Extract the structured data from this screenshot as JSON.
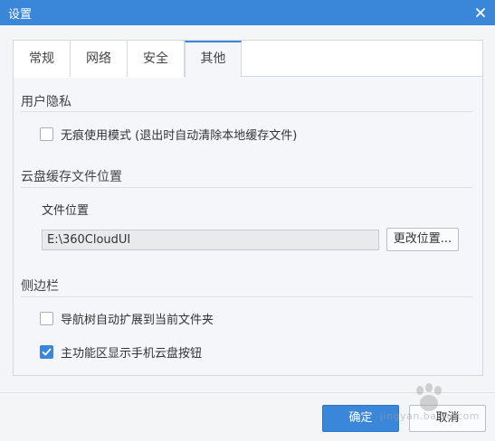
{
  "window": {
    "title": "设置"
  },
  "tabs": [
    {
      "label": "常规"
    },
    {
      "label": "网络"
    },
    {
      "label": "安全"
    },
    {
      "label": "其他"
    }
  ],
  "privacy": {
    "title": "用户隐私",
    "incognito_label": "无痕使用模式 (退出时自动清除本地缓存文件)",
    "incognito_checked": false
  },
  "cache": {
    "title": "云盘缓存文件位置",
    "location_label": "文件位置",
    "location_value": "E:\\360CloudUI",
    "change_button": "更改位置..."
  },
  "sidebar": {
    "title": "侧边栏",
    "options": [
      {
        "label": "导航树自动扩展到当前文件夹",
        "checked": false
      },
      {
        "label": "主功能区显示手机云盘按钮",
        "checked": true
      }
    ]
  },
  "footer": {
    "ok_label": "确定",
    "cancel_label": "取消"
  },
  "watermark": {
    "text": "jingyan.baidu.com"
  },
  "colors": {
    "accent": "#3a86d9"
  }
}
